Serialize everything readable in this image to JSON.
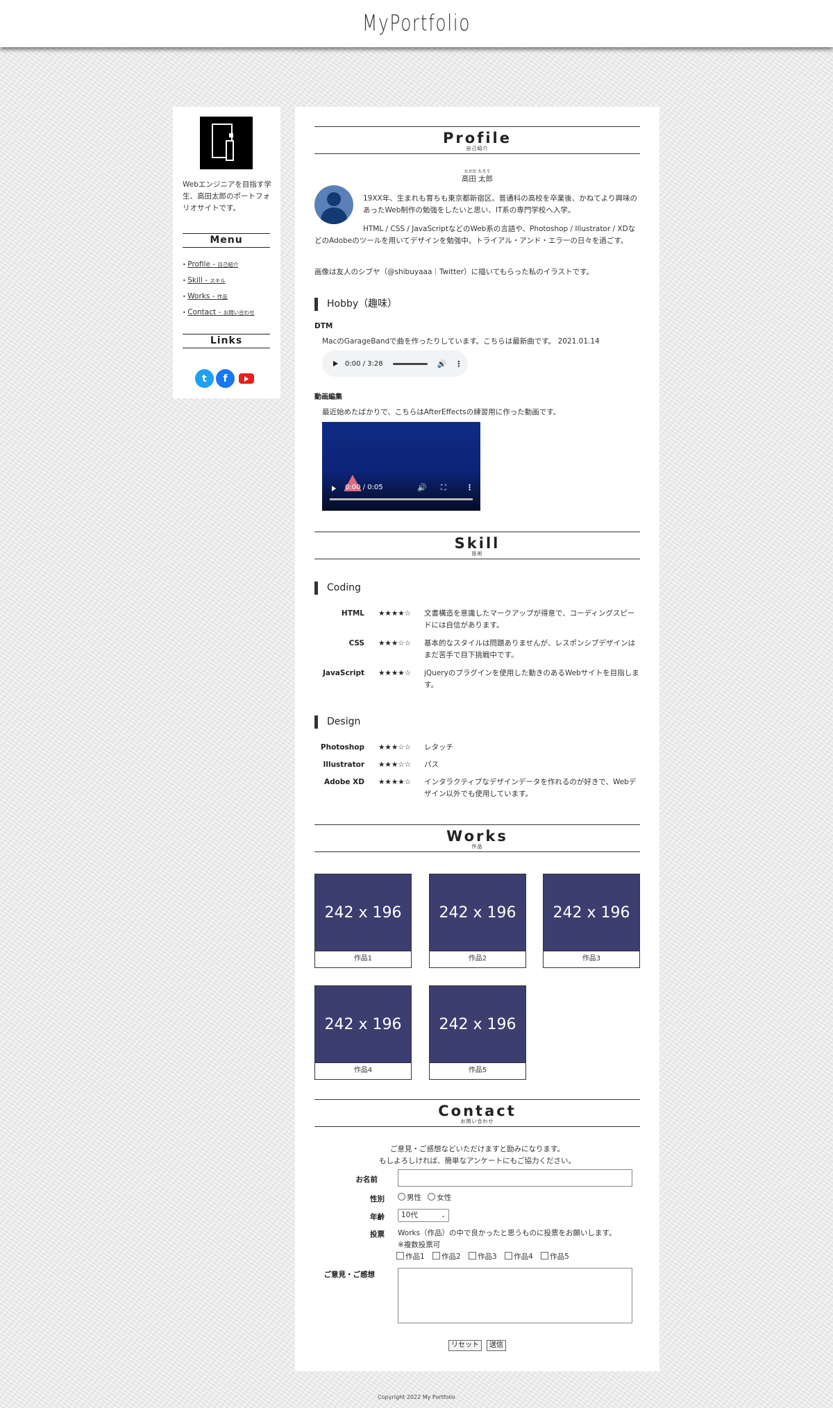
{
  "header": {
    "logo": "MyPortfolio"
  },
  "sidebar": {
    "intro": "Webエンジニアを目指す学生、高田太郎のポートフォリオサイトです。",
    "menu_heading": "Menu",
    "menu": [
      {
        "label": "Profile - ",
        "sub": "自己紹介"
      },
      {
        "label": "Skill - ",
        "sub": "スキル"
      },
      {
        "label": "Works - ",
        "sub": "作品"
      },
      {
        "label": "Contact - ",
        "sub": "お問い合わせ"
      }
    ],
    "links_heading": "Links",
    "links": [
      {
        "name": "twitter",
        "color": "#1da1f2",
        "glyph": "t"
      },
      {
        "name": "facebook",
        "color": "#1877f2",
        "glyph": "f"
      },
      {
        "name": "youtube",
        "color": "#e62117"
      }
    ]
  },
  "profile": {
    "title": "Profile",
    "subtitle": "自己紹介",
    "name_ruby": "たかだ たろう",
    "name": "高田 太郎",
    "p1": "19XX年、生まれも育ちも東京都新宿区。普通科の高校を卒業後、かねてより興味のあったWeb制作の勉強をしたいと思い、IT系の専門学校へ入学。",
    "p2": "HTML / CSS / JavaScriptなどのWeb系の言語や、Photoshop / Illustrator / XDなどのAdobeのツールを用いてデザインを勉強中。トライアル・アンド・エラーの日々を過ごす。",
    "p3": "画像は友人のシブヤ（@shibuyaaa｜Twitter）に描いてもらった私のイラストです。",
    "hobby_heading": "Hobby（趣味）",
    "dtm_heading": "DTM",
    "dtm_text": "MacのGarageBandで曲を作ったりしています。こちらは最新曲です。 2021.01.14",
    "audio_time": "0:00 / 3:28",
    "video_heading": "動画編集",
    "video_text": "最近始めたばかりで、こちらはAfterEffectsの練習用に作った動画です。",
    "video_time": "0:00 / 0:05"
  },
  "skill": {
    "title": "Skill",
    "subtitle": "技術",
    "coding_heading": "Coding",
    "coding": [
      {
        "name": "HTML",
        "stars": "★★★★☆",
        "desc": "文書構造を意識したマークアップが得意で、コーディングスピードには自信があります。"
      },
      {
        "name": "CSS",
        "stars": "★★★☆☆",
        "desc": "基本的なスタイルは問題ありませんが、レスポンシブデザインはまだ苦手で目下挑戦中です。"
      },
      {
        "name": "JavaScript",
        "stars": "★★★★☆",
        "desc": "jQueryのプラグインを使用した動きのあるWebサイトを目指します。"
      }
    ],
    "design_heading": "Design",
    "design": [
      {
        "name": "Photoshop",
        "stars": "★★★☆☆",
        "desc": "レタッチ"
      },
      {
        "name": "Illustrator",
        "stars": "★★★☆☆",
        "desc": "パス"
      },
      {
        "name": "Adobe XD",
        "stars": "★★★★☆",
        "desc": "インタラクティブなデザインデータを作れるのが好きで、Webデザイン以外でも使用しています。"
      }
    ]
  },
  "works": {
    "title": "Works",
    "subtitle": "作品",
    "items": [
      {
        "thumb": "242 x 196",
        "caption": "作品1"
      },
      {
        "thumb": "242 x 196",
        "caption": "作品2"
      },
      {
        "thumb": "242 x 196",
        "caption": "作品3"
      },
      {
        "thumb": "242 x 196",
        "caption": "作品4"
      },
      {
        "thumb": "242 x 196",
        "caption": "作品5"
      }
    ]
  },
  "contact": {
    "title": "Contact",
    "subtitle": "お問い合わせ",
    "lead1": "ご意見・ご感想などいただけますと励みになります。",
    "lead2": "もしよろしければ、簡単なアンケートにもご協力ください。",
    "name_label": "お名前",
    "gender_label": "性別",
    "gender_options": [
      "男性",
      "女性"
    ],
    "age_label": "年齢",
    "age_value": "10代",
    "vote_label": "投票",
    "vote_text": "Works（作品）の中で良かったと思うものに投票をお願いします。",
    "vote_note": "※複数投票可",
    "vote_options": [
      "作品1",
      "作品2",
      "作品3",
      "作品4",
      "作品5"
    ],
    "comment_label": "ご意見・ご感想",
    "reset": "リセット",
    "submit": "送信"
  },
  "footer": {
    "copyright": "Copyright 2022 My Portfolio"
  }
}
